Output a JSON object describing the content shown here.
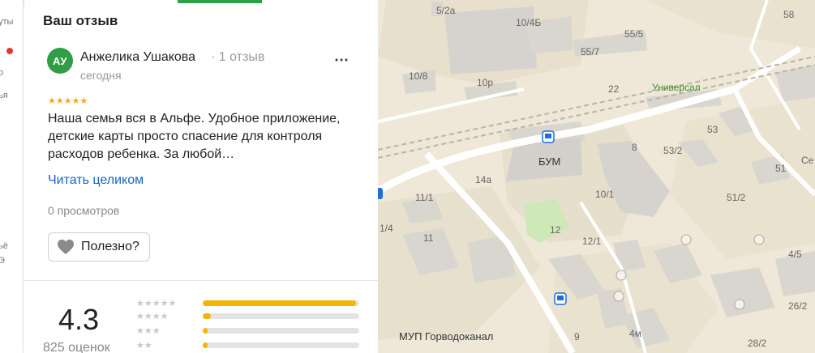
{
  "sidebar_edge": {
    "labels": [
      "уты",
      "о",
      "ья",
      "ьё",
      "Э"
    ]
  },
  "review": {
    "section_title": "Ваш отзыв",
    "avatar_initials": "АУ",
    "author": "Анжелика Ушакова",
    "author_reviews": "· 1 отзыв",
    "date": "сегодня",
    "stars": "★★★★★",
    "text": "Наша семья вся в Альфе. Удобное приложение, детские карты просто спасение для контроля расходов ребенка. За любой…",
    "read_more": "Читать целиком",
    "views": "0 просмотров",
    "useful_label": "Полезно?"
  },
  "rating": {
    "value": "4.3",
    "count_label": "825 оценок",
    "distribution": [
      {
        "stars": "★★★★★",
        "fraction": 0.98
      },
      {
        "stars": "★★★★",
        "fraction": 0.05
      },
      {
        "stars": "★★★",
        "fraction": 0.03
      },
      {
        "stars": "★★",
        "fraction": 0.03
      }
    ]
  },
  "map": {
    "labels": [
      "5/2а",
      "10/4Б",
      "58",
      "55/5",
      "55/7",
      "10/8",
      "10р",
      "22",
      "Универсал",
      "53",
      "53/2",
      "Се",
      "8",
      "51",
      "БУМ",
      "14а",
      "11/1",
      "10/1",
      "51/2",
      "12",
      "12/1",
      "1/4",
      "11",
      "4/5",
      "26/2",
      "МУП Горводоканал",
      "9",
      "4м",
      "28/2"
    ]
  },
  "colors": {
    "accent": "#2ea043",
    "star": "#f5b400",
    "link": "#1565c0"
  }
}
